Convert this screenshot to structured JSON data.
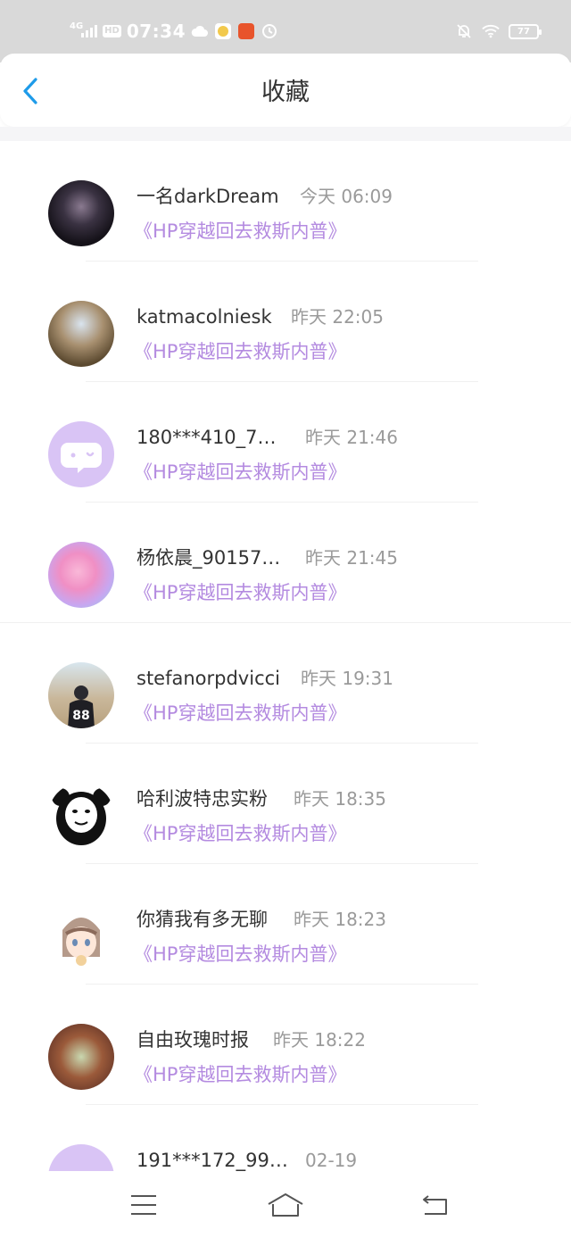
{
  "status_bar": {
    "network": "4G",
    "hd": "HD",
    "time": "07:34",
    "battery": "77",
    "icons": [
      "signal-icon",
      "cloud-icon",
      "app-icon",
      "app-icon",
      "sync-icon",
      "mute-bell-icon",
      "wifi-icon",
      "battery-icon"
    ]
  },
  "header": {
    "title": "收藏",
    "back_icon": "chevron-left-icon",
    "accent_color": "#1e9be9"
  },
  "items": [
    {
      "name": "一名darkDream",
      "time": "今天 06:09",
      "book": "《HP穿越回去救斯内普》",
      "avatar": "photo"
    },
    {
      "name": "katmacolniesk",
      "time": "昨天 22:05",
      "book": "《HP穿越回去救斯内普》",
      "avatar": "photo"
    },
    {
      "name": "180***410_7…",
      "time": "昨天 21:46",
      "book": "《HP穿越回去救斯内普》",
      "avatar": "default-chat-bubble"
    },
    {
      "name": "杨依晨_90157…",
      "time": "昨天 21:45",
      "book": "《HP穿越回去救斯内普》",
      "avatar": "photo"
    },
    {
      "name": "stefanorpdvicci",
      "time": "昨天 19:31",
      "book": "《HP穿越回去救斯内普》",
      "avatar": "photo"
    },
    {
      "name": "哈利波特忠实粉",
      "time": "昨天 18:35",
      "book": "《HP穿越回去救斯内普》",
      "avatar": "photo"
    },
    {
      "name": "你猜我有多无聊",
      "time": "昨天 18:23",
      "book": "《HP穿越回去救斯内普》",
      "avatar": "photo"
    },
    {
      "name": "自由玫瑰时报",
      "time": "昨天 18:22",
      "book": "《HP穿越回去救斯内普》",
      "avatar": "photo"
    },
    {
      "name": "191***172_99…",
      "time": "02-19",
      "book": "",
      "avatar": "default-chat-bubble"
    }
  ],
  "colors": {
    "book_title": "#b48be0",
    "timestamp": "#9a9a9a",
    "default_avatar": "#d9c4f5"
  },
  "nav_bar": {
    "icons": [
      "menu-icon",
      "home-icon",
      "back-icon"
    ]
  }
}
